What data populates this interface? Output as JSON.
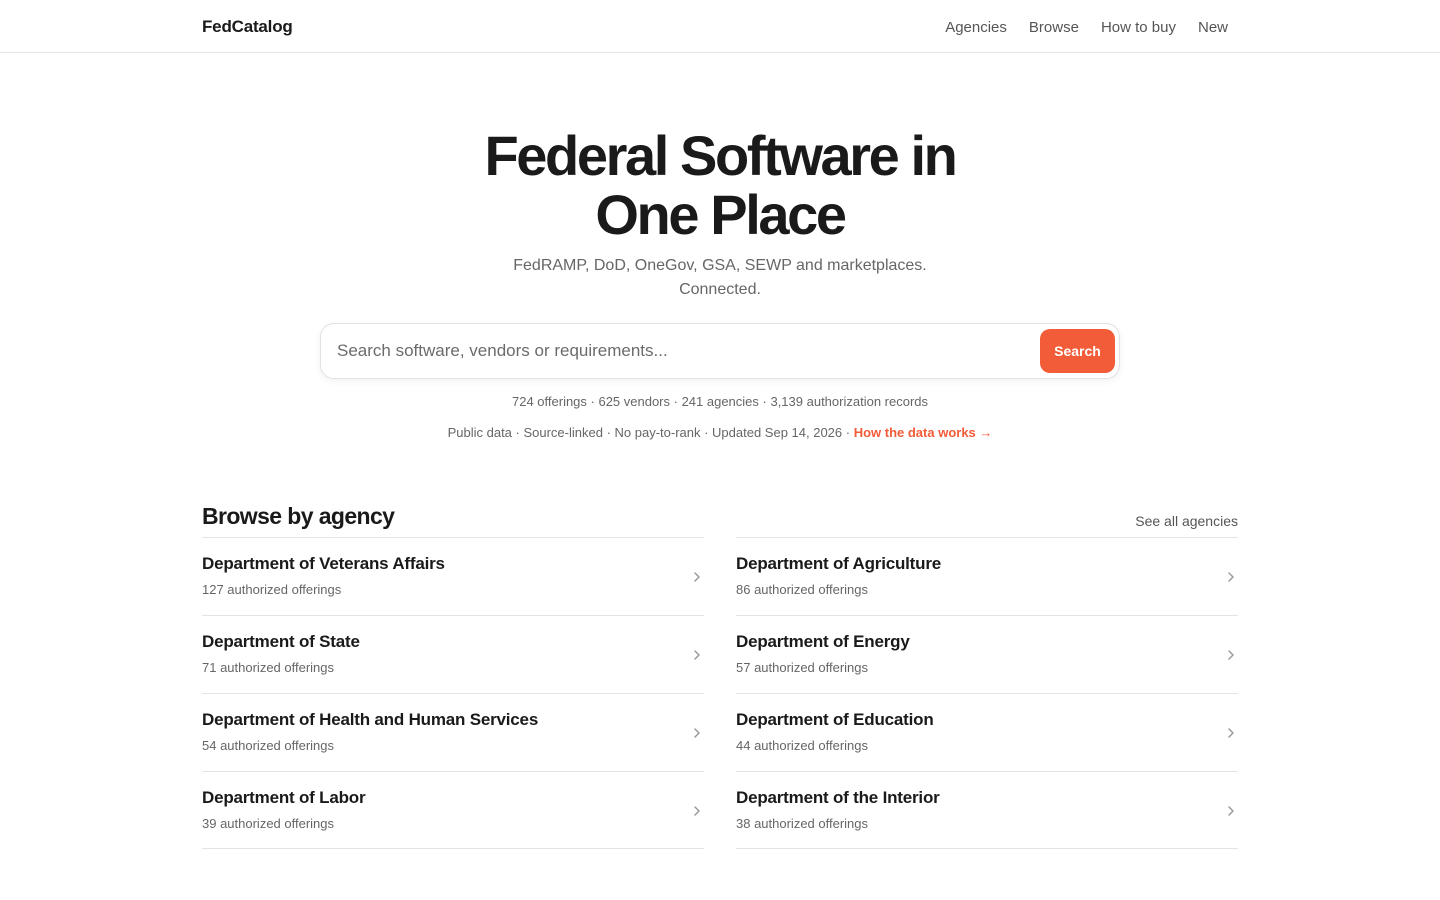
{
  "header": {
    "brand": "FedCatalog",
    "nav": [
      "Agencies",
      "Browse",
      "How to buy",
      "New"
    ]
  },
  "hero": {
    "title_line1": "Federal Software in",
    "title_line2": "One Place",
    "subtitle_line1": "FedRAMP, DoD, OneGov, GSA, SEWP and marketplaces.",
    "subtitle_line2": "Connected."
  },
  "search": {
    "placeholder": "Search software, vendors or requirements...",
    "value": "",
    "button_label": "Search"
  },
  "stats": "724 offerings · 625 vendors · 241 agencies · 3,139 authorization records",
  "meta": {
    "text": "Public data · Source-linked · No pay-to-rank · Updated Sep 14, 2026 · ",
    "link_label": "How the data works →"
  },
  "agencies_section": {
    "title": "Browse by agency",
    "see_all": "See all agencies",
    "items": [
      {
        "name": "Department of Veterans Affairs",
        "count": "127 authorized offerings"
      },
      {
        "name": "Department of Agriculture",
        "count": "86 authorized offerings"
      },
      {
        "name": "Department of State",
        "count": "71 authorized offerings"
      },
      {
        "name": "Department of Energy",
        "count": "57 authorized offerings"
      },
      {
        "name": "Department of Health and Human Services",
        "count": "54 authorized offerings"
      },
      {
        "name": "Department of Education",
        "count": "44 authorized offerings"
      },
      {
        "name": "Department of Labor",
        "count": "39 authorized offerings"
      },
      {
        "name": "Department of the Interior",
        "count": "38 authorized offerings"
      }
    ]
  },
  "colors": {
    "accent": "#f25c38",
    "text": "#1a1a1a",
    "muted": "#666666",
    "divider": "#e4e4e4"
  },
  "icons": {
    "row_chevron": "chevron-right-icon"
  }
}
